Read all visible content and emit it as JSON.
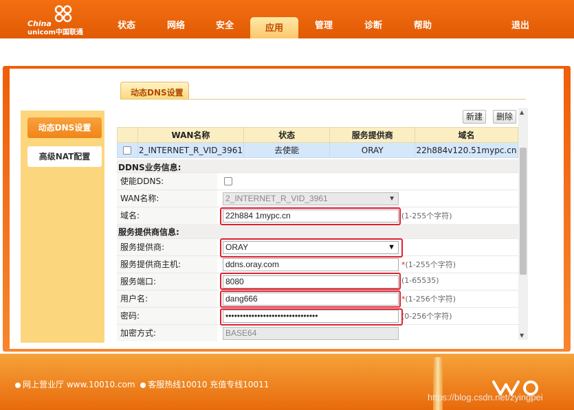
{
  "brand": {
    "line1": "China",
    "line2": "unicom中国联通"
  },
  "nav": {
    "items": [
      "状态",
      "网络",
      "安全",
      "应用",
      "管理",
      "诊断",
      "帮助"
    ],
    "logout": "退出",
    "active": "应用"
  },
  "page_tab": "动态DNS设置",
  "sidebar": {
    "items": [
      {
        "label": "动态DNS设置",
        "active": true
      },
      {
        "label": "高级NAT配置",
        "active": false
      }
    ]
  },
  "toolbar": {
    "new_label": "新建",
    "delete_label": "删除"
  },
  "wan_table": {
    "headers": [
      "WAN名称",
      "状态",
      "服务提供商",
      "域名"
    ],
    "rows": [
      {
        "wan": "2_INTERNET_R_VID_3961",
        "status": "去使能",
        "provider": "ORAY",
        "domain": "22h884v120.51mypc.cn"
      }
    ]
  },
  "ddns_section": {
    "title": "DDNS业务信息:",
    "enable_label": "使能DDNS:",
    "wan_label": "WAN名称:",
    "wan_value": "2_INTERNET_R_VID_3961",
    "domain_label": "域名:",
    "domain_value": "22h884        1mypc.cn",
    "domain_hint": "(1-255个字符)"
  },
  "provider_section": {
    "title": "服务提供商信息:",
    "provider_label": "服务提供商:",
    "provider_value": "ORAY",
    "host_label": "服务提供商主机:",
    "host_value": "ddns.oray.com",
    "host_hint": "(1-255个字符)",
    "port_label": "服务端口:",
    "port_value": "8080",
    "port_hint": "(1-65535)",
    "user_label": "用户名:",
    "user_value": "dang666",
    "user_hint": "(1-256个字符)",
    "pwd_label": "密码:",
    "pwd_value": "••••••••••••••••••••••••••••••••",
    "pwd_hint": "(0-256个字符)",
    "enc_label": "加密方式:",
    "enc_value": "BASE64"
  },
  "footer": {
    "hall": "网上营业厅  www.10010.com",
    "hotline": "客服热线10010  充值专线10011",
    "logo_text": "沃"
  },
  "watermark": "https://blog.csdn.net/zyingpei",
  "colors": {
    "brand_orange": "#e15a05",
    "highlight_red": "#e0202e",
    "row_blue": "#d5e7fb"
  }
}
